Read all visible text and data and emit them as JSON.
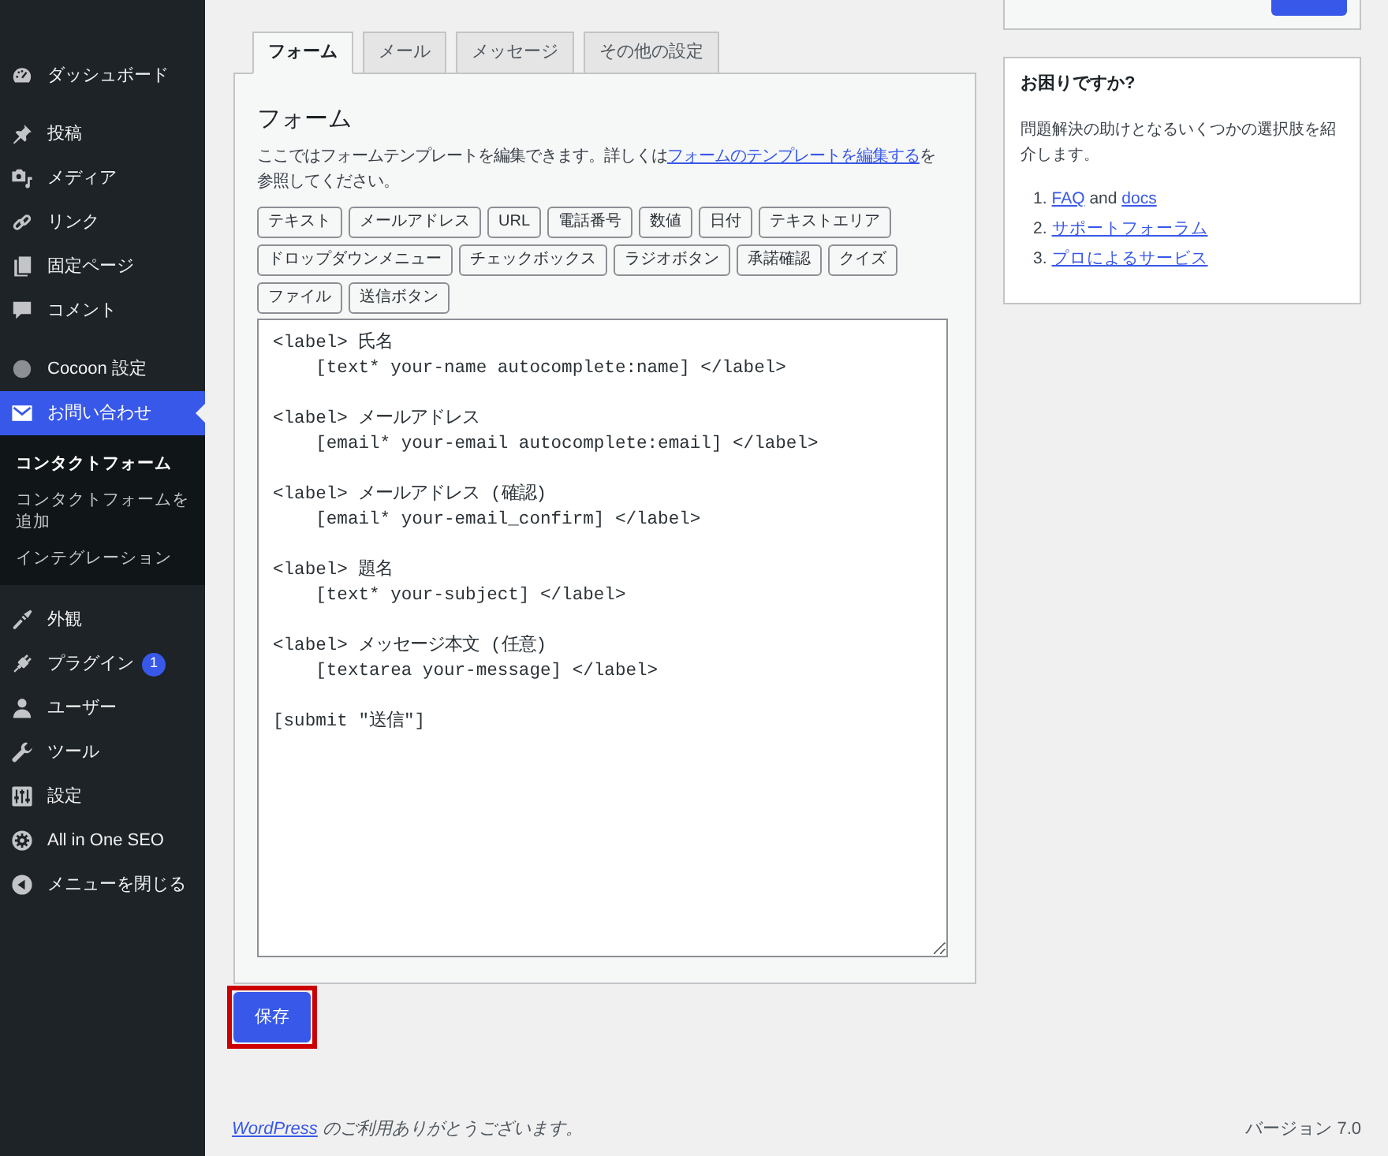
{
  "sidebar": {
    "groups": [
      [
        {
          "label": "ダッシュボード",
          "selected": false
        }
      ],
      [
        {
          "label": "投稿",
          "selected": false
        },
        {
          "label": "メディア",
          "selected": false
        },
        {
          "label": "リンク",
          "selected": false
        },
        {
          "label": "固定ページ",
          "selected": false
        },
        {
          "label": "コメント",
          "selected": false
        }
      ],
      [
        {
          "label": "Cocoon 設定",
          "selected": false
        },
        {
          "label": "お問い合わせ",
          "selected": true,
          "submenu": [
            {
              "label": "コンタクトフォーム",
              "selected": true
            },
            {
              "label": "コンタクトフォームを追加",
              "selected": false
            },
            {
              "label": "インテグレーション",
              "selected": false
            }
          ]
        },
        {
          "label": "外観",
          "selected": false
        },
        {
          "label": "プラグイン",
          "selected": false,
          "badge": "1"
        },
        {
          "label": "ユーザー",
          "selected": false
        },
        {
          "label": "ツール",
          "selected": false
        },
        {
          "label": "設定",
          "selected": false
        },
        {
          "label": "All in One SEO",
          "selected": false
        },
        {
          "label": "メニューを閉じる",
          "selected": false
        }
      ]
    ]
  },
  "tabs": [
    {
      "label": "フォーム",
      "selected": true
    },
    {
      "label": "メール",
      "selected": false
    },
    {
      "label": "メッセージ",
      "selected": false
    },
    {
      "label": "その他の設定",
      "selected": false
    }
  ],
  "form_panel": {
    "heading": "フォーム",
    "description": {
      "before": "ここではフォームテンプレートを編集できます。詳しくは",
      "link": "フォームのテンプレートを編集する",
      "after": "を参照してください。"
    },
    "tag_buttons": [
      "テキスト",
      "メールアドレス",
      "URL",
      "電話番号",
      "数値",
      "日付",
      "テキストエリア",
      "ドロップダウンメニュー",
      "チェックボックス",
      "ラジオボタン",
      "承諾確認",
      "クイズ",
      "ファイル",
      "送信ボタン"
    ],
    "template": "<label> 氏名\n    [text* your-name autocomplete:name] </label>\n\n<label> メールアドレス\n    [email* your-email autocomplete:email] </label>\n\n<label> メールアドレス (確認)\n    [email* your-email_confirm] </label>\n\n<label> 題名\n    [text* your-subject] </label>\n\n<label> メッセージ本文 (任意)\n    [textarea your-message] </label>\n\n[submit \"送信\"]"
  },
  "save_button": {
    "label": "保存",
    "highlighted": true
  },
  "help_box": {
    "title": "お困りですか?",
    "text": "問題解決の助けとなるいくつかの選択肢を紹介します。",
    "items": [
      {
        "number": "1.",
        "parts": [
          {
            "kind": "link",
            "text": "FAQ"
          },
          {
            "kind": "text",
            "text": " and "
          },
          {
            "kind": "link",
            "text": "docs"
          }
        ]
      },
      {
        "number": "2.",
        "parts": [
          {
            "kind": "link",
            "text": "サポートフォーラム"
          }
        ]
      },
      {
        "number": "3.",
        "parts": [
          {
            "kind": "link",
            "text": "プロによるサービス"
          }
        ]
      }
    ]
  },
  "footer": {
    "link": "WordPress",
    "text": " のご利用ありがとうございます。",
    "version": "バージョン 7.0"
  }
}
